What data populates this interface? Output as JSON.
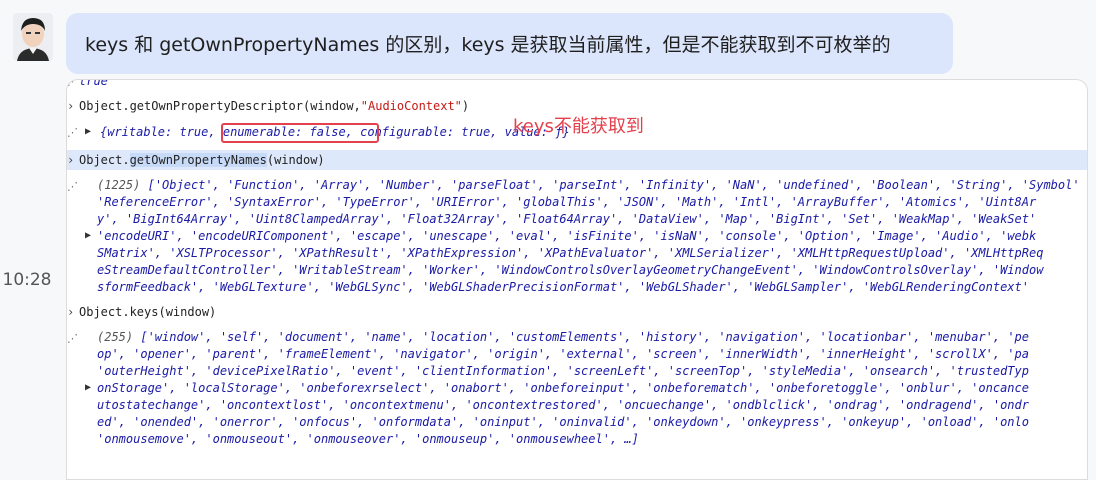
{
  "message": {
    "time": "10:28",
    "text": "keys 和 getOwnPropertyNames 的区别，keys 是获取当前属性，但是不能获取到不可枚举的"
  },
  "annotation": {
    "text": "keys不能获取到",
    "color": "#e5414d"
  },
  "console": {
    "top_partial": "true",
    "cmd1": {
      "fn": "Object.getOwnPropertyDescriptor",
      "args_open": "(window,",
      "arg_str": "\"AudioContext\"",
      "args_close": ")"
    },
    "result1": {
      "open": "{",
      "writable": "writable: true,",
      "enumerable": "enumerable: false,",
      "configurable": "configurable: true,",
      "value": "value: ƒ}"
    },
    "cmd2": {
      "obj": "Object.",
      "fn": "getOwnPropertyNames",
      "args": "(window)"
    },
    "result2": {
      "count": "(1225)",
      "lines": [
        "['Object', 'Function', 'Array', 'Number', 'parseFloat', 'parseInt', 'Infinity', 'NaN', 'undefined', 'Boolean', 'String', 'Symbol'",
        "'ReferenceError', 'SyntaxError', 'TypeError', 'URIError', 'globalThis', 'JSON', 'Math', 'Intl', 'ArrayBuffer', 'Atomics', 'Uint8Ar",
        "y', 'BigInt64Array', 'Uint8ClampedArray', 'Float32Array', 'Float64Array', 'DataView', 'Map', 'BigInt', 'Set', 'WeakMap', 'WeakSet'",
        "'encodeURI', 'encodeURIComponent', 'escape', 'unescape', 'eval', 'isFinite', 'isNaN', 'console', 'Option', 'Image', 'Audio', 'webk",
        "SMatrix', 'XSLTProcessor', 'XPathResult', 'XPathExpression', 'XPathEvaluator', 'XMLSerializer', 'XMLHttpRequestUpload', 'XMLHttpReq",
        "eStreamDefaultController', 'WritableStream', 'Worker', 'WindowControlsOverlayGeometryChangeEvent', 'WindowControlsOverlay', 'Window",
        "sformFeedback', 'WebGLTexture', 'WebGLSync', 'WebGLShaderPrecisionFormat', 'WebGLShader', 'WebGLSampler', 'WebGLRenderingContext'"
      ]
    },
    "cmd3": {
      "text": "Object.keys(window)"
    },
    "result3": {
      "count": "(255)",
      "lines": [
        "['window', 'self', 'document', 'name', 'location', 'customElements', 'history', 'navigation', 'locationbar', 'menubar', 'pe",
        "op', 'opener', 'parent', 'frameElement', 'navigator', 'origin', 'external', 'screen', 'innerWidth', 'innerHeight', 'scrollX', 'pa",
        "'outerHeight', 'devicePixelRatio', 'event', 'clientInformation', 'screenLeft', 'screenTop', 'styleMedia', 'onsearch', 'trustedTyp",
        "onStorage', 'localStorage', 'onbeforexrselect', 'onabort', 'onbeforeinput', 'onbeforematch', 'onbeforetoggle', 'onblur', 'oncance",
        "utostatechange', 'oncontextlost', 'oncontextmenu', 'oncontextrestored', 'oncuechange', 'ondblclick', 'ondrag', 'ondragend', 'ondr",
        "ed', 'onended', 'onerror', 'onfocus', 'onformdata', 'oninput', 'oninvalid', 'onkeydown', 'onkeypress', 'onkeyup', 'onload', 'onlo",
        "'onmousemove', 'onmouseout', 'onmouseover', 'onmouseup', 'onmousewheel', …]"
      ]
    }
  }
}
